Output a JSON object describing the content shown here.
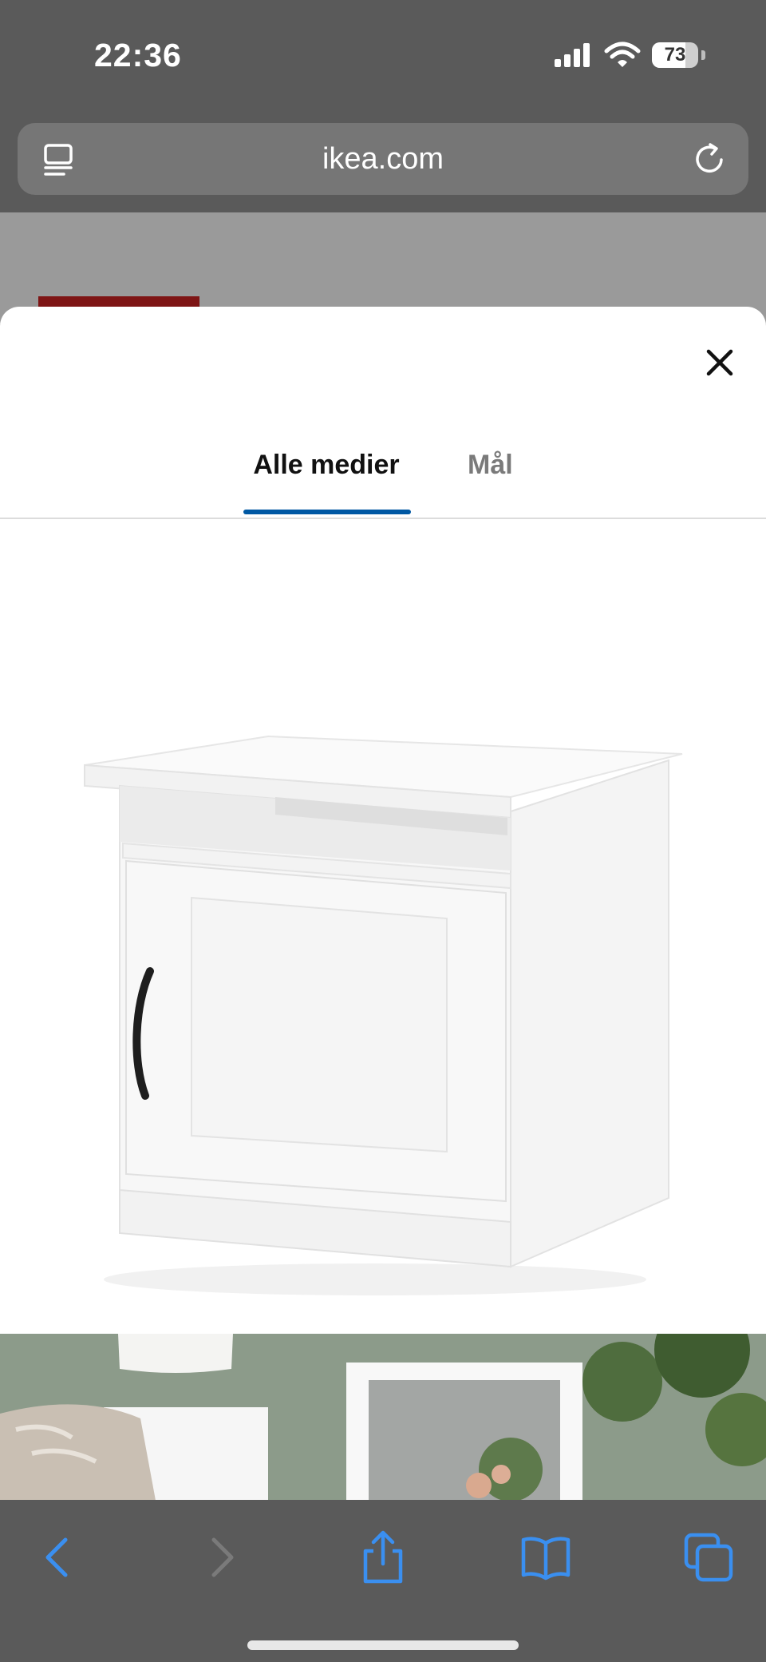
{
  "status_bar": {
    "time": "22:36",
    "battery": "73",
    "battery_level": 0.73,
    "icons": [
      "signal-icon",
      "wifi-icon",
      "battery-icon"
    ]
  },
  "browser": {
    "url": "ikea.com",
    "left_icon": "reader-icon",
    "right_icon": "reload-icon"
  },
  "sheet": {
    "close_icon": "close-icon",
    "tabs": [
      {
        "label": "Alle medier",
        "active": true
      },
      {
        "label": "Mål",
        "active": false
      }
    ],
    "accent_color": "#0058a3",
    "images": [
      {
        "subject": "white bedside table with door"
      },
      {
        "subject": "bedroom scene with lamp and plant"
      }
    ]
  },
  "toolbar": {
    "items": [
      "back-icon",
      "forward-icon",
      "share-icon",
      "bookmarks-icon",
      "tabs-icon"
    ]
  },
  "colors": {
    "ui_blue": "#3a8ff0",
    "ikea_red": "#7e1515"
  }
}
